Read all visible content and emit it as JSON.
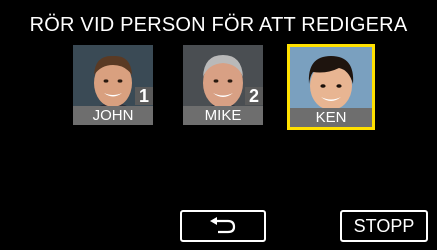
{
  "screen": {
    "title": "RÖR VID PERSON FÖR ATT REDIGERA"
  },
  "faces": [
    {
      "name": "JOHN",
      "number": "1",
      "selected": false
    },
    {
      "name": "MIKE",
      "number": "2",
      "selected": false
    },
    {
      "name": "KEN",
      "number": "",
      "selected": true
    }
  ],
  "buttons": {
    "back_icon": "return-arrow-icon",
    "stop_label": "STOPP"
  },
  "colors": {
    "selection": "#ffe000",
    "name_bar": "#6e6e6e",
    "background": "#000000"
  }
}
